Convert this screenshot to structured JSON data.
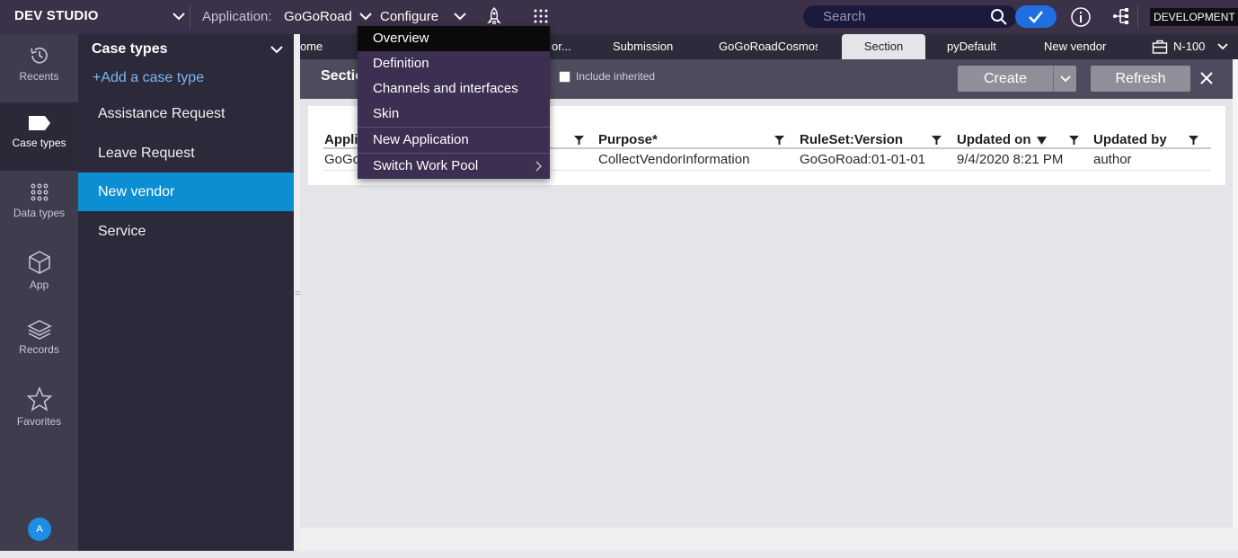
{
  "topbar": {
    "brand": "DEV STUDIO",
    "application_label": "Application:",
    "application_name": "GoGoRoad",
    "configure_label": "Configure",
    "search_placeholder": "Search",
    "environment": "DEVELOPMENT"
  },
  "rail": {
    "items": [
      {
        "label": "Recents",
        "icon": "history-icon"
      },
      {
        "label": "Case types",
        "icon": "case-type-icon"
      },
      {
        "label": "Data types",
        "icon": "dots-grid-icon"
      },
      {
        "label": "App",
        "icon": "cube-icon"
      },
      {
        "label": "Records",
        "icon": "layers-icon"
      },
      {
        "label": "Favorites",
        "icon": "star-icon"
      }
    ],
    "active": "Case types",
    "avatar_initial": "A"
  },
  "case_panel": {
    "title": "Case types",
    "add_label": "+Add a case type",
    "items": [
      "Assistance Request",
      "Leave Request",
      "New vendor",
      "Service"
    ],
    "selected": "New vendor"
  },
  "tabs": {
    "items": [
      "ome",
      "or...",
      "Submission",
      "GoGoRoadCosmos",
      "Section",
      "pyDefault",
      "New vendor"
    ],
    "active": "Section",
    "overflow_label": "N-100"
  },
  "header": {
    "title": "Section",
    "include_inherited": "Include inherited",
    "create_label": "Create",
    "refresh_label": "Refresh"
  },
  "table": {
    "columns": [
      "Appli",
      "Purpose*",
      "RuleSet:Version",
      "Updated on",
      "Updated by"
    ],
    "rows": [
      {
        "app": "GoGo",
        "purpose": "CollectVendorInformation",
        "ruleset": "GoGoRoad:01-01-01",
        "updated_on": "9/4/2020 8:21 PM",
        "updated_by": "author"
      }
    ]
  },
  "menu": {
    "items": [
      "Overview",
      "Definition",
      "Channels and interfaces",
      "Skin",
      "New Application",
      "Switch Work Pool"
    ],
    "hovered": "Overview"
  }
}
